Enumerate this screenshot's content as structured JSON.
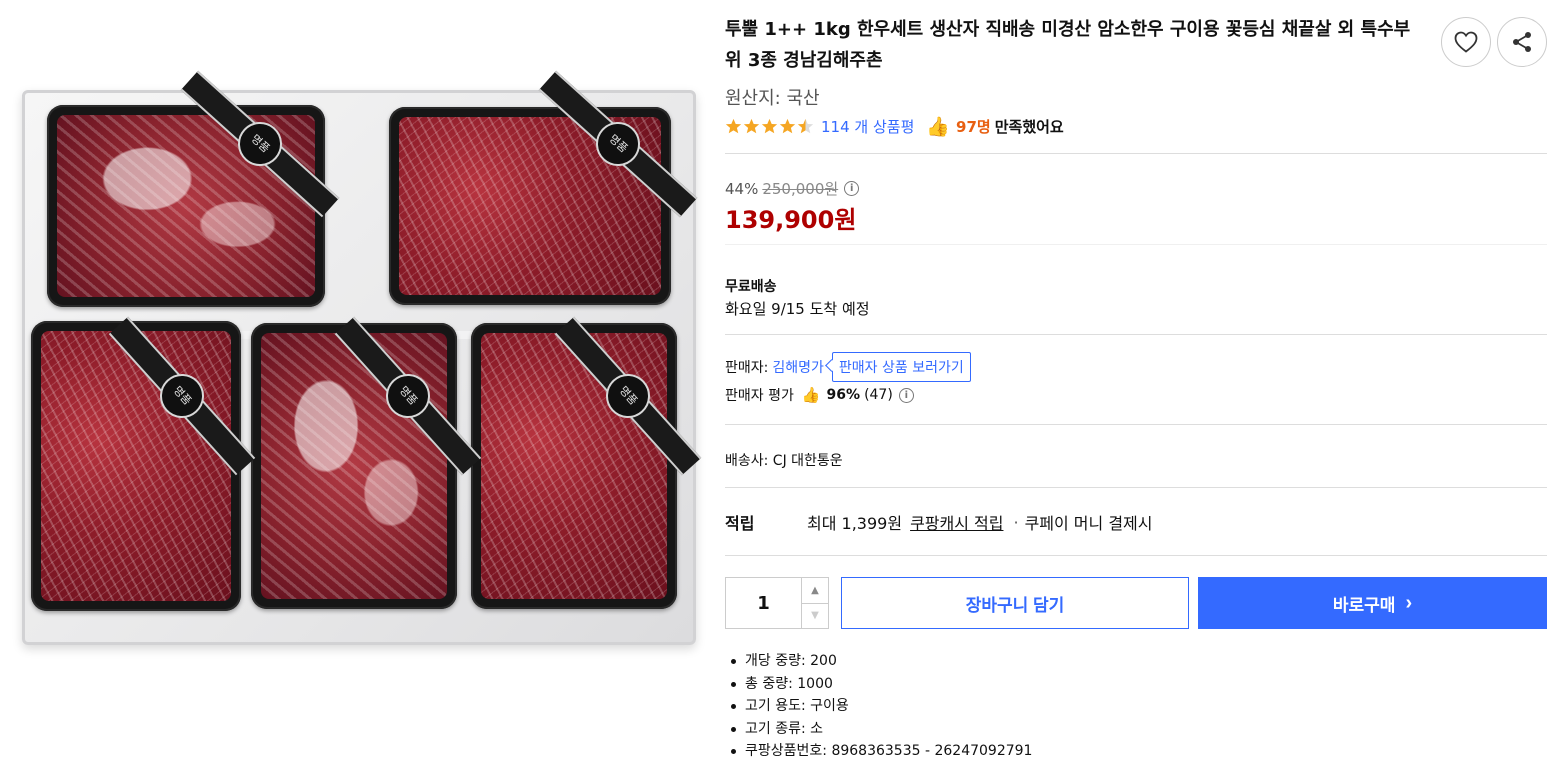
{
  "product": {
    "title": "투뿔 1++ 1kg 한우세트 생산자 직배송 미경산 암소한우 구이용 꽃등심 채끝살 외 특수부위 3종 경남김해주촌",
    "origin": "원산지: 국산",
    "rating": 4.5,
    "review_count": "114 개 상품평",
    "satisfied_count": "97명",
    "satisfied_text": "만족했어요",
    "image_alt": "한우 선물세트 5팩",
    "package_brand_text": "명품"
  },
  "price": {
    "discount_rate": "44%",
    "original_price": "250,000원",
    "sale_price": "139,900원",
    "info_icon": "info-icon"
  },
  "shipping": {
    "label": "무료배송",
    "arrival": "화요일 9/15 도착 예정"
  },
  "seller": {
    "label": "판매자:",
    "name": "김해명가",
    "products_button": "판매자 상품 보러가기",
    "rating_label": "판매자 평가",
    "rating_score": "96%",
    "rating_count": "(47)"
  },
  "carrier": {
    "text": "배송사:  CJ 대한통운"
  },
  "reward": {
    "label": "적립",
    "max": "최대 1,399원",
    "link": "쿠팡캐시 적립",
    "note": "쿠페이 머니 결제시"
  },
  "purchase": {
    "quantity": "1",
    "cart_button": "장바구니 담기",
    "buy_button": "바로구매"
  },
  "specs": [
    "개당 중량: 200",
    "총 중량: 1000",
    "고기 용도: 구이용",
    "고기 종류: 소",
    "쿠팡상품번호: 8968363535 - 26247092791"
  ],
  "icons": {
    "wishlist": "heart-icon",
    "share": "share-icon",
    "thumb": "thumbs-up-icon"
  },
  "colors": {
    "accent": "#346aff",
    "price": "#ae0000",
    "star": "#f5a623",
    "satisfied": "#e85f10"
  }
}
